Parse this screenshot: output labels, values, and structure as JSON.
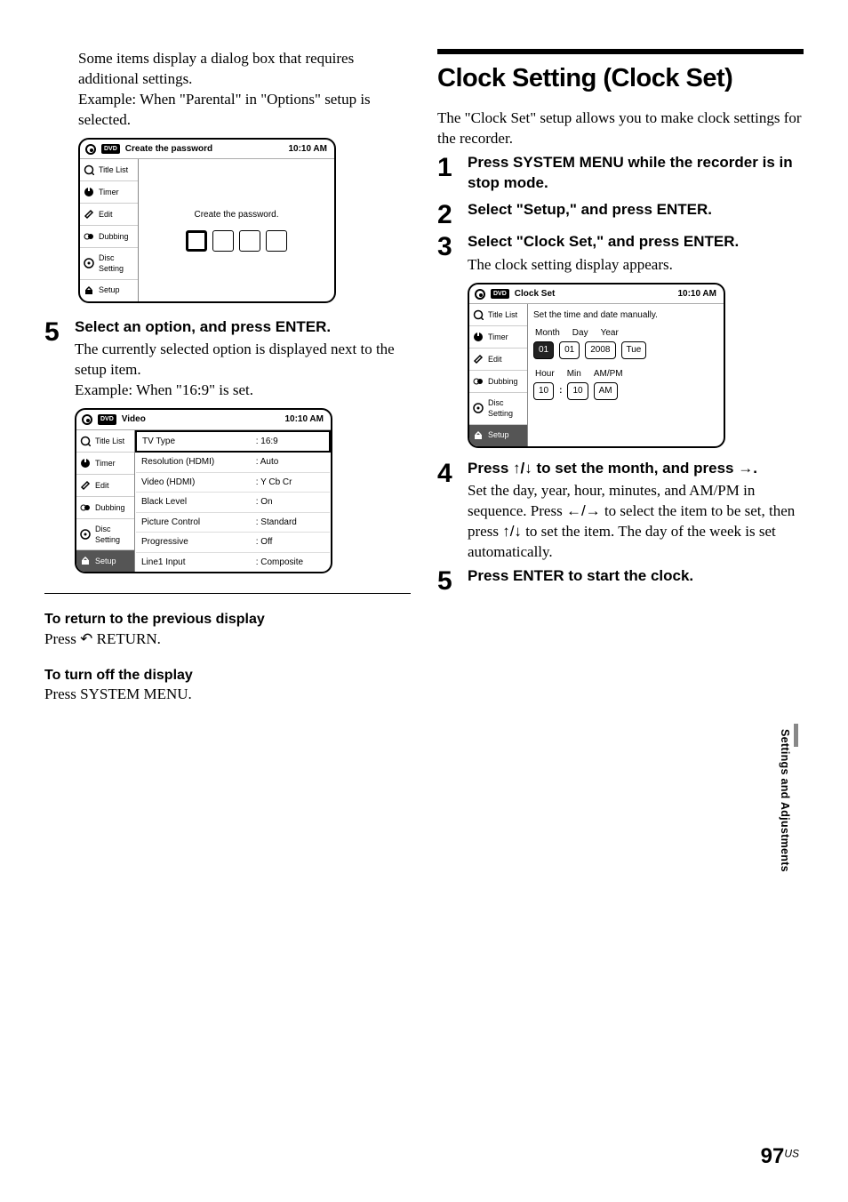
{
  "left": {
    "intro1": "Some items display a dialog box that requires additional settings.",
    "intro2": "Example: When \"Parental\" in \"Options\" setup is selected.",
    "osd1": {
      "dvd_badge": "DVD",
      "title": "Create the password",
      "time": "10:10 AM",
      "sidebar": [
        "Title List",
        "Timer",
        "Edit",
        "Dubbing",
        "Disc Setting",
        "Setup"
      ],
      "content_text": "Create the password."
    },
    "step5": {
      "num": "5",
      "title": "Select an option, and press ENTER.",
      "body1": "The currently selected option is displayed next to the setup item.",
      "body2": "Example: When \"16:9\" is set."
    },
    "osd2": {
      "dvd_badge": "DVD",
      "title": "Video",
      "time": "10:10 AM",
      "sidebar": [
        "Title List",
        "Timer",
        "Edit",
        "Dubbing",
        "Disc Setting",
        "Setup"
      ],
      "rows": [
        {
          "k": "TV Type",
          "v": ": 16:9"
        },
        {
          "k": "Resolution (HDMI)",
          "v": ": Auto"
        },
        {
          "k": "Video (HDMI)",
          "v": ": Y Cb Cr"
        },
        {
          "k": "Black Level",
          "v": ": On"
        },
        {
          "k": "Picture Control",
          "v": ": Standard"
        },
        {
          "k": "Progressive",
          "v": ": Off"
        },
        {
          "k": "Line1 Input",
          "v": ": Composite"
        }
      ]
    },
    "return": {
      "h": "To return to the previous display",
      "b_pre": "Press ",
      "b_post": " RETURN."
    },
    "turnoff": {
      "h": "To turn off the display",
      "b": "Press SYSTEM MENU."
    }
  },
  "right": {
    "h1": "Clock Setting (Clock Set)",
    "intro": "The \"Clock Set\" setup allows you to make clock settings for the recorder.",
    "step1": {
      "num": "1",
      "title": "Press SYSTEM MENU while the recorder is in stop mode."
    },
    "step2": {
      "num": "2",
      "title": "Select \"Setup,\" and press ENTER."
    },
    "step3": {
      "num": "3",
      "title": "Select \"Clock Set,\" and press ENTER.",
      "body": "The clock setting display appears."
    },
    "osd3": {
      "dvd_badge": "DVD",
      "title": "Clock Set",
      "time": "10:10 AM",
      "sidebar": [
        "Title List",
        "Timer",
        "Edit",
        "Dubbing",
        "Disc Setting",
        "Setup"
      ],
      "msg": "Set the time and date manually.",
      "labels_date": [
        "Month",
        "Day",
        "Year"
      ],
      "values_date": [
        "01",
        "01",
        "2008",
        "Tue"
      ],
      "labels_time": [
        "Hour",
        "Min",
        "AM/PM"
      ],
      "values_time": [
        "10",
        "10",
        "AM"
      ]
    },
    "step4": {
      "num": "4",
      "title_pre": "Press ",
      "title_mid": " to set the month, and press ",
      "title_post": ".",
      "body_pre": "Set the day, year, hour, minutes, and AM/PM in sequence. Press ",
      "body_mid": " to select the item to be set, then press ",
      "body_post": " to set the item. The day of the week is set automatically."
    },
    "step5": {
      "num": "5",
      "title": "Press ENTER to start the clock."
    }
  },
  "sidetab": "Settings and Adjustments",
  "page": {
    "num": "97",
    "suffix": "US"
  }
}
